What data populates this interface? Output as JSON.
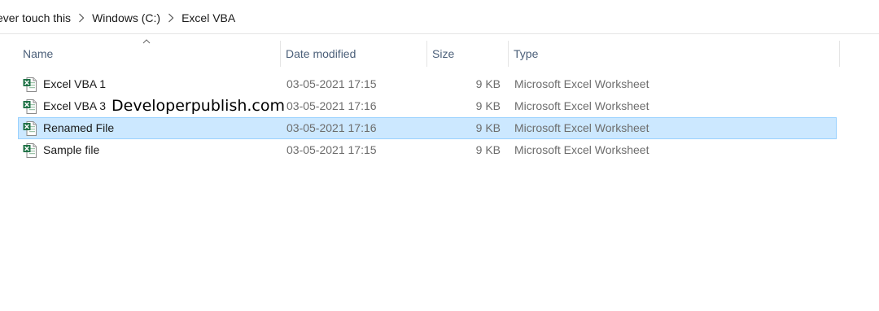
{
  "breadcrumb": {
    "items": [
      "ever touch this",
      "Windows (C:)",
      "Excel VBA"
    ]
  },
  "columns": {
    "name": "Name",
    "date_modified": "Date modified",
    "size": "Size",
    "type": "Type",
    "sorted_by": "Name",
    "sort_direction": "ascending"
  },
  "files": [
    {
      "name": "Excel VBA 1",
      "date": "03-05-2021 17:15",
      "size": "9 KB",
      "type": "Microsoft Excel Worksheet",
      "icon": "excel-file-icon",
      "selected": false
    },
    {
      "name": "Excel VBA 3",
      "date": "03-05-2021 17:16",
      "size": "9 KB",
      "type": "Microsoft Excel Worksheet",
      "icon": "excel-file-icon",
      "selected": false
    },
    {
      "name": "Renamed File",
      "date": "03-05-2021 17:16",
      "size": "9 KB",
      "type": "Microsoft Excel Worksheet",
      "icon": "excel-file-icon",
      "selected": true
    },
    {
      "name": "Sample file",
      "date": "03-05-2021 17:15",
      "size": "9 KB",
      "type": "Microsoft Excel Worksheet",
      "icon": "excel-file-icon",
      "selected": false
    }
  ],
  "watermark": "Developerpublish.com",
  "colors": {
    "selection_bg": "#cce8ff",
    "selection_border": "#99d1ff",
    "header_text": "#4c607a",
    "excel_green": "#1e7145"
  }
}
